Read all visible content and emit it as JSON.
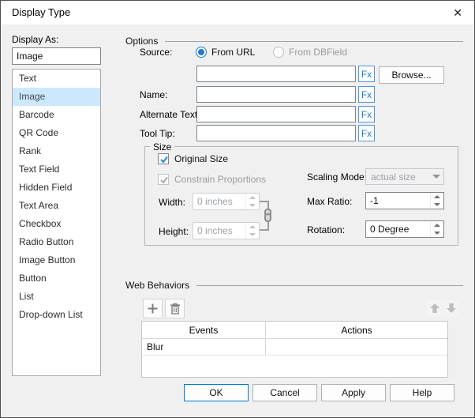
{
  "window": {
    "title": "Display Type",
    "close_glyph": "✕"
  },
  "display_as": {
    "label": "Display As:",
    "value": "Image",
    "items": [
      "Text",
      "Image",
      "Barcode",
      "QR Code",
      "Rank",
      "Text Field",
      "Hidden Field",
      "Text Area",
      "Checkbox",
      "Radio Button",
      "Image Button",
      "Button",
      "List",
      "Drop-down List"
    ],
    "selected": "Image"
  },
  "options": {
    "header": "Options",
    "source_label": "Source:",
    "from_url": "From URL",
    "from_dbfield": "From DBField",
    "url_value": "",
    "fx": "Fx",
    "browse": "Browse...",
    "name_label": "Name:",
    "name_value": "",
    "alt_label": "Alternate Text:",
    "alt_value": "",
    "tooltip_label": "Tool Tip:",
    "tooltip_value": ""
  },
  "size": {
    "header": "Size",
    "original_size": "Original Size",
    "original_size_checked": true,
    "constrain": "Constrain Proportions",
    "constrain_checked": true,
    "width_label": "Width:",
    "width_value": "0 inches",
    "height_label": "Height:",
    "height_value": "0 inches",
    "scaling_label": "Scaling Mode:",
    "scaling_value": "actual size",
    "max_ratio_label": "Max Ratio:",
    "max_ratio_value": "-1",
    "rotation_label": "Rotation:",
    "rotation_value": "0 Degree"
  },
  "web_behaviors": {
    "header": "Web Behaviors",
    "columns": [
      "Events",
      "Actions"
    ],
    "rows": [
      {
        "event": "Blur",
        "action": ""
      }
    ]
  },
  "footer": {
    "ok": "OK",
    "cancel": "Cancel",
    "apply": "Apply",
    "help": "Help"
  },
  "colors": {
    "accent": "#0078d7",
    "selection": "#cce8ff",
    "fx_blue": "#1c7cd0",
    "dialog_bg": "#f0f0f0"
  }
}
